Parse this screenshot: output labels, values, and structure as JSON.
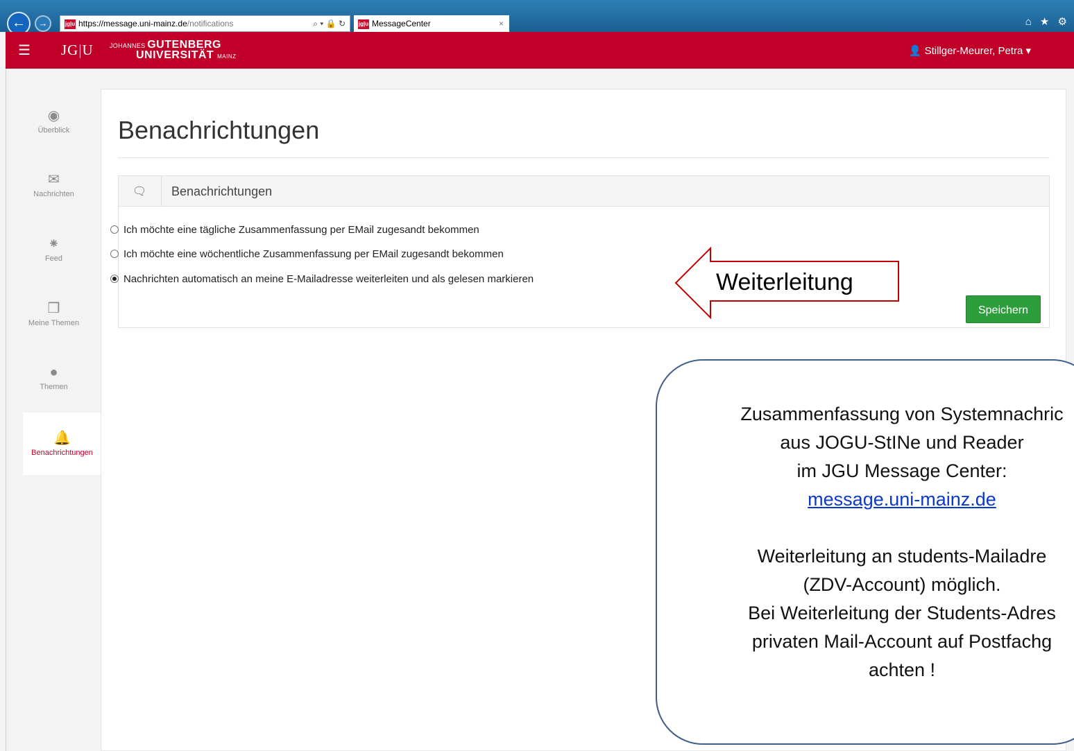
{
  "browser": {
    "url_scheme": "https://",
    "url_host": "message.uni-mainz.de",
    "url_path": "/notifications",
    "favicon_text": "jg|u",
    "tab_title": "MessageCenter",
    "tab_close": "×",
    "tools": "⌕ ▾ 🔒 ↻",
    "chrome_icons": "⌂ ★ ⚙"
  },
  "header": {
    "logo_abbr": "JG|U",
    "uni_line1_prefix": "JOHANNES",
    "uni_line1_main": "GUTENBERG",
    "uni_line2_main": "UNIVERSITÄT",
    "uni_line2_suffix": "MAINZ",
    "user": "Stillger-Meurer, Petra"
  },
  "sidebar": {
    "items": [
      {
        "label": "Überblick",
        "icon": "dashboard-icon"
      },
      {
        "label": "Nachrichten",
        "icon": "envelope-icon"
      },
      {
        "label": "Feed",
        "icon": "rss-icon"
      },
      {
        "label": "Meine Themen",
        "icon": "pin-icon"
      },
      {
        "label": "Themen",
        "icon": "globe-icon"
      },
      {
        "label": "Benachrichtungen",
        "icon": "bell-icon",
        "active": true
      }
    ]
  },
  "main": {
    "title": "Benachrichtungen",
    "panel_title": "Benachrichtungen",
    "options": [
      {
        "label": "Ich möchte eine tägliche Zusammenfassung per EMail zugesandt bekommen",
        "checked": false
      },
      {
        "label": "Ich möchte eine wöchentliche Zusammenfassung per EMail zugesandt bekommen",
        "checked": false
      },
      {
        "label": "Nachrichten automatisch an meine E-Mailadresse weiterleiten und als gelesen markieren",
        "checked": true
      }
    ],
    "save_label": "Speichern"
  },
  "annotation": {
    "arrow_label": "Weiterleitung",
    "info_lines": [
      "Zusammenfassung von Systemnachric",
      "aus JOGU-StINe und Reader",
      "im JGU Message Center:",
      "message.uni-mainz.de",
      "",
      "Weiterleitung an students-Mailadre",
      "(ZDV-Account) möglich.",
      "Bei Weiterleitung der Students-Adres",
      "privaten Mail-Account auf Postfachg",
      "achten !"
    ]
  },
  "colors": {
    "brand": "#c1002a",
    "save": "#2e9e3c",
    "arrow": "#c00000",
    "info_border": "#3f5d86",
    "link": "#0b39c9"
  }
}
